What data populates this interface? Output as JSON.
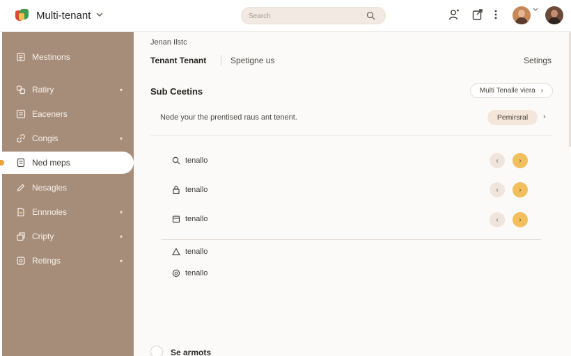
{
  "header": {
    "app_title": "Multi-tenant",
    "search_placeholder": "Search",
    "icons": [
      "user-plus-icon",
      "share-icon",
      "more-vertical-icon"
    ]
  },
  "sidebar": {
    "items": [
      {
        "label": "Mestinons",
        "icon": "list-icon",
        "has_caret": false
      },
      {
        "label": "Ratiry",
        "icon": "users-icon",
        "has_caret": true
      },
      {
        "label": "Eaceners",
        "icon": "grid-icon",
        "has_caret": false
      },
      {
        "label": "Congis",
        "icon": "link-icon",
        "has_caret": true
      },
      {
        "label": "Ned meps",
        "icon": "document-icon",
        "has_caret": false,
        "active": true
      },
      {
        "label": "Nesagles",
        "icon": "pen-icon",
        "has_caret": false
      },
      {
        "label": "Ennnoles",
        "icon": "file-icon",
        "has_caret": true
      },
      {
        "label": "Cripty",
        "icon": "layers-icon",
        "has_caret": true
      },
      {
        "label": "Retings",
        "icon": "settings-icon",
        "has_caret": true
      }
    ]
  },
  "main": {
    "breadcrumb": "Jenan Ilstc",
    "tabs": {
      "active": "Tenant Tenant",
      "other": "Spetigne us",
      "settings": "Setings"
    },
    "section_title": "Sub Ceetins",
    "view_button": "Multi Tenalle viera",
    "notice": "Nede your the prentised raus ant tenent.",
    "permission_button": "Pemirsral",
    "rows": [
      {
        "label": "tenallo",
        "icon": "search-icon",
        "pager": true
      },
      {
        "label": "tenallo",
        "icon": "lock-icon",
        "pager": true
      },
      {
        "label": "tenallo",
        "icon": "card-icon",
        "pager": true
      },
      {
        "label": "tenallo",
        "icon": "alert-icon",
        "pager": false
      },
      {
        "label": "tenallo",
        "icon": "globe-icon",
        "pager": false
      }
    ],
    "bottom_label": "Se armots"
  },
  "colors": {
    "sidebar": "#a68d79",
    "accent": "#f2bf5e",
    "active_marker": "#e8a338",
    "search_bg": "#f1e9e2"
  }
}
